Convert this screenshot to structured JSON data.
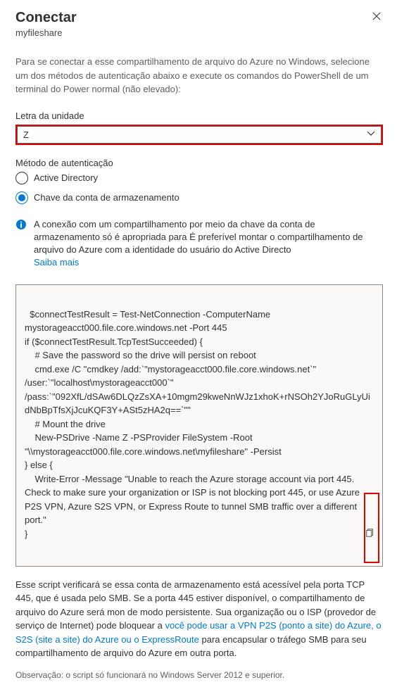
{
  "header": {
    "title": "Conectar",
    "subtitle": "myfileshare"
  },
  "intro": "Para se conectar a esse compartilhamento de arquivo do Azure no Windows, selecione um dos métodos de autenticação abaixo e execute os comandos do PowerShell de um terminal do Power normal (não elevado):",
  "driveLetter": {
    "label": "Letra da unidade",
    "value": "Z"
  },
  "authMethod": {
    "label": "Método de autenticação",
    "options": [
      {
        "label": "Active Directory",
        "selected": false
      },
      {
        "label": "Chave da conta de armazenamento",
        "selected": true
      }
    ]
  },
  "info": {
    "text": "A conexão com um compartilhamento por meio da chave da conta de armazenamento só é apropriada para É preferível montar o compartilhamento de arquivo do Azure com a identidade do usuário do Active Directo",
    "link": "Saiba mais"
  },
  "code": "$connectTestResult = Test-NetConnection -ComputerName mystorageacct000.file.core.windows.net -Port 445\nif ($connectTestResult.TcpTestSucceeded) {\n    # Save the password so the drive will persist on reboot\n    cmd.exe /C \"cmdkey /add:`\"mystorageacct000.file.core.windows.net`\" /user:`\"localhost\\mystorageacct000`\" /pass:`\"092XfL/dSAw6DLQzZsXA+10mgm29kweNnWJz1xhoK+rNSOh2YJoRuGLyUidNbBpTfsXjJcuKQF3Y+ASt5zHA2q==`\"\"\n    # Mount the drive\n    New-PSDrive -Name Z -PSProvider FileSystem -Root \"\\\\mystorageacct000.file.core.windows.net\\myfileshare\" -Persist\n} else {\n    Write-Error -Message \"Unable to reach the Azure storage account via port 445. Check to make sure your organization or ISP is not blocking port 445, or use Azure P2S VPN, Azure S2S VPN, or Express Route to tunnel SMB traffic over a different port.\"\n}",
  "desc": {
    "part1": "Esse script verificará se essa conta de armazenamento está acessível pela porta TCP 445, que é usada pelo SMB. Se a porta 445 estiver disponível, o compartilhamento de arquivo do Azure será mon de modo persistente. Sua organização ou o ISP (provedor de serviço de Internet) pode bloquear a ",
    "link": "você pode usar a VPN P2S (ponto a site) do Azure, o S2S (site a site) do Azure ou o ExpressRoute",
    "part2": " para encapsular o tráfego SMB para seu compartilhamento de arquivo do Azure em outra porta."
  },
  "note": "Observação: o script só funcionará no Windows Server 2012 e superior."
}
